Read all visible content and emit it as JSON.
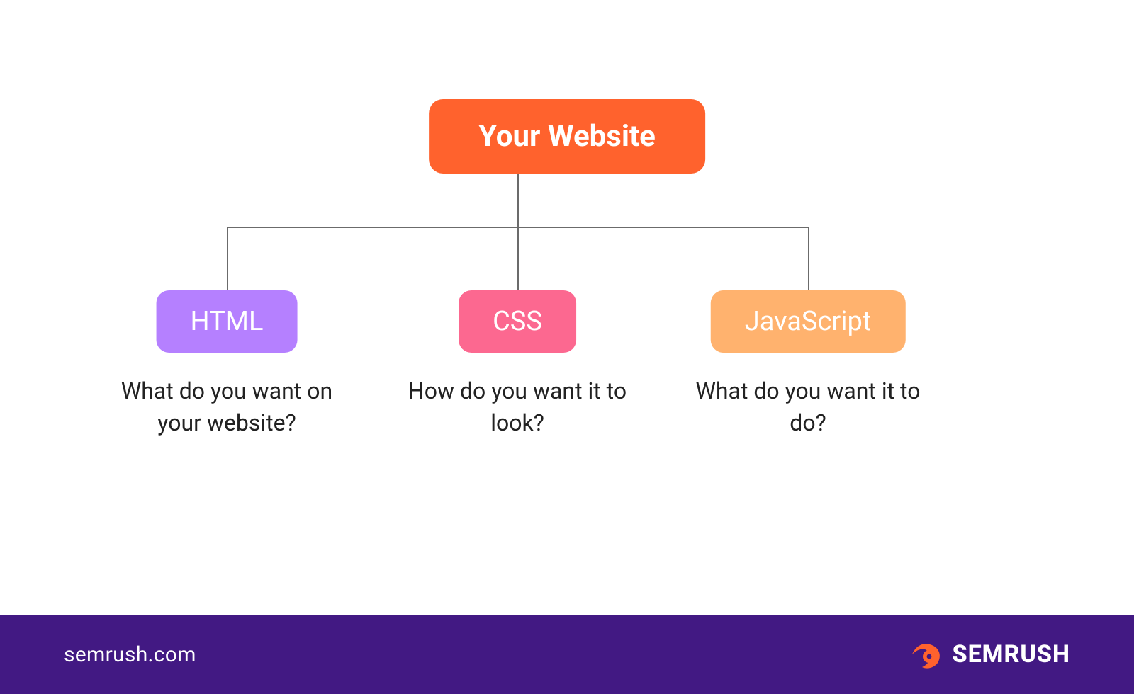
{
  "colors": {
    "root": "#FF622D",
    "html": "#B580FF",
    "css": "#FC6890",
    "js": "#FFB26E",
    "footer": "#421983",
    "line": "#6b6b6b"
  },
  "diagram": {
    "root": {
      "label": "Your Website"
    },
    "children": [
      {
        "id": "html",
        "label": "HTML",
        "caption": "What do you want on your website?"
      },
      {
        "id": "css",
        "label": "CSS",
        "caption": "How do you want it to look?"
      },
      {
        "id": "js",
        "label": "JavaScript",
        "caption": "What do you want it to do?"
      }
    ]
  },
  "footer": {
    "url": "semrush.com",
    "brand": "SEMRUSH"
  }
}
